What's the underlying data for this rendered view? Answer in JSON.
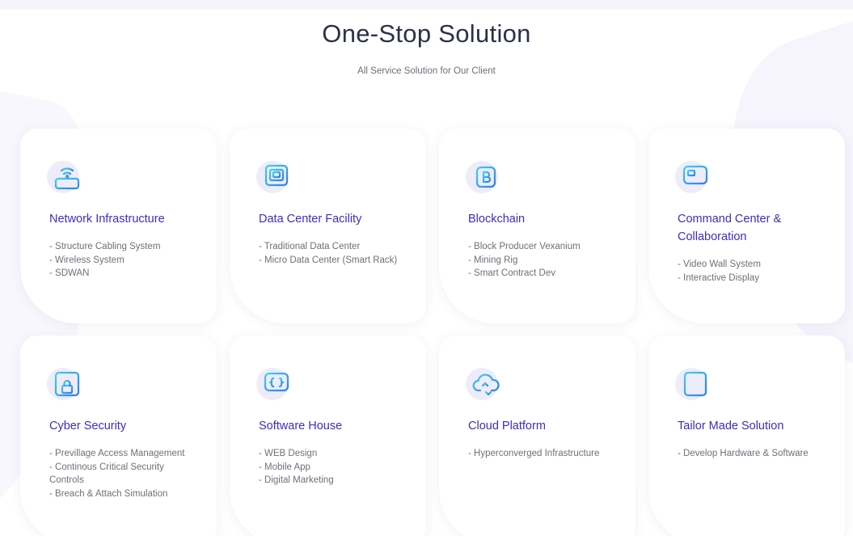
{
  "header": {
    "title": "One-Stop Solution",
    "subtitle": "All Service Solution for Our Client"
  },
  "colors": {
    "accent": "#3a2fc2",
    "icon_gradient_start": "#3fd0f5",
    "icon_gradient_end": "#2f7fe8",
    "halo": "#eeecf8"
  },
  "cards": [
    {
      "icon": "network-router-icon",
      "title": "Network Infrastructure",
      "items": [
        "- Structure Cabling System",
        "- Wireless System",
        "- SDWAN"
      ]
    },
    {
      "icon": "data-center-icon",
      "title": "Data Center Facility",
      "items": [
        "- Traditional Data Center",
        "- Micro Data Center (Smart Rack)"
      ]
    },
    {
      "icon": "blockchain-chip-icon",
      "title": "Blockchain",
      "items": [
        "- Block Producer Vexanium",
        "- Mining Rig",
        "- Smart Contract Dev"
      ]
    },
    {
      "icon": "command-center-monitor-icon",
      "title": "Command Center & Collaboration",
      "items": [
        "- Video Wall System",
        "- Interactive Display"
      ]
    },
    {
      "icon": "cyber-security-lock-icon",
      "title": "Cyber Security",
      "items": [
        "- Previllage Access Management",
        "- Continous Critical Security Controls",
        "- Breach & Attach Simulation"
      ]
    },
    {
      "icon": "software-code-icon",
      "title": "Software House",
      "items": [
        "- WEB Design",
        "- Mobile App",
        "- Digital Marketing"
      ]
    },
    {
      "icon": "cloud-upload-icon",
      "title": "Cloud Platform",
      "items": [
        "- Hyperconverged Infrastructure"
      ]
    },
    {
      "icon": "tailor-made-document-icon",
      "title": "Tailor Made Solution",
      "items": [
        "- Develop Hardware & Software"
      ]
    }
  ]
}
